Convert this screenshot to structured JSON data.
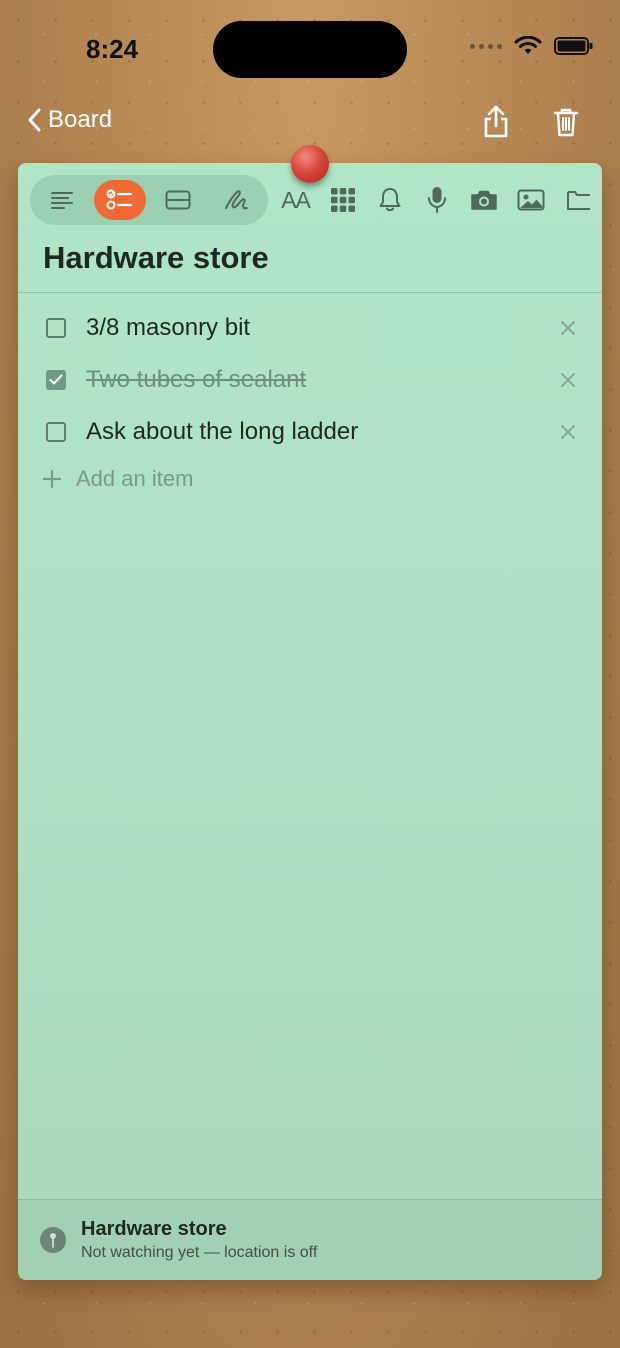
{
  "status_bar": {
    "time": "8:24"
  },
  "nav": {
    "back_label": "Board"
  },
  "note": {
    "title": "Hardware store",
    "items": [
      {
        "text": "3/8 masonry bit",
        "checked": false
      },
      {
        "text": "Two tubes of sealant",
        "checked": true
      },
      {
        "text": "Ask about the long ladder",
        "checked": false
      }
    ],
    "add_item_placeholder": "Add an item"
  },
  "toolbar": {
    "modes": [
      "text-icon",
      "checklist-icon",
      "card-icon",
      "sketch-icon"
    ],
    "active_mode": "checklist-icon",
    "font_button": "AA",
    "tools": [
      "grid-icon",
      "bell-icon",
      "microphone-icon",
      "camera-icon",
      "image-icon",
      "folder-icon"
    ]
  },
  "location": {
    "title": "Hardware store",
    "status": "Not watching yet — location is off"
  },
  "colors": {
    "note_background": "#b0e5c6",
    "accent": "#ef6a32",
    "pin": "#d9453a",
    "board": "#b88a55"
  }
}
